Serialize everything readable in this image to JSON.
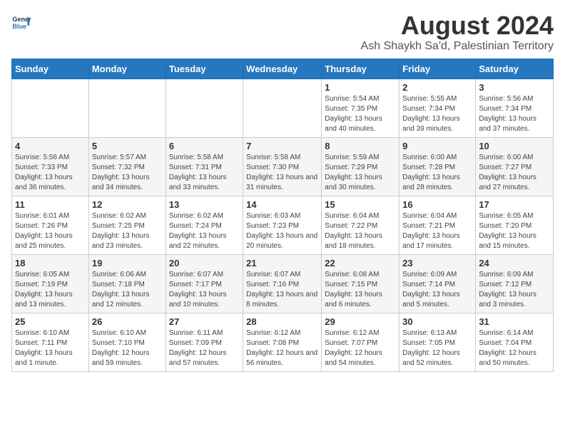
{
  "logo": {
    "text_general": "General",
    "text_blue": "Blue"
  },
  "title": "August 2024",
  "subtitle": "Ash Shaykh Sa'd, Palestinian Territory",
  "days_of_week": [
    "Sunday",
    "Monday",
    "Tuesday",
    "Wednesday",
    "Thursday",
    "Friday",
    "Saturday"
  ],
  "weeks": [
    [
      {
        "day": "",
        "info": ""
      },
      {
        "day": "",
        "info": ""
      },
      {
        "day": "",
        "info": ""
      },
      {
        "day": "",
        "info": ""
      },
      {
        "day": "1",
        "info": "Sunrise: 5:54 AM\nSunset: 7:35 PM\nDaylight: 13 hours and 40 minutes."
      },
      {
        "day": "2",
        "info": "Sunrise: 5:55 AM\nSunset: 7:34 PM\nDaylight: 13 hours and 39 minutes."
      },
      {
        "day": "3",
        "info": "Sunrise: 5:56 AM\nSunset: 7:34 PM\nDaylight: 13 hours and 37 minutes."
      }
    ],
    [
      {
        "day": "4",
        "info": "Sunrise: 5:56 AM\nSunset: 7:33 PM\nDaylight: 13 hours and 36 minutes."
      },
      {
        "day": "5",
        "info": "Sunrise: 5:57 AM\nSunset: 7:32 PM\nDaylight: 13 hours and 34 minutes."
      },
      {
        "day": "6",
        "info": "Sunrise: 5:58 AM\nSunset: 7:31 PM\nDaylight: 13 hours and 33 minutes."
      },
      {
        "day": "7",
        "info": "Sunrise: 5:58 AM\nSunset: 7:30 PM\nDaylight: 13 hours and 31 minutes."
      },
      {
        "day": "8",
        "info": "Sunrise: 5:59 AM\nSunset: 7:29 PM\nDaylight: 13 hours and 30 minutes."
      },
      {
        "day": "9",
        "info": "Sunrise: 6:00 AM\nSunset: 7:28 PM\nDaylight: 13 hours and 28 minutes."
      },
      {
        "day": "10",
        "info": "Sunrise: 6:00 AM\nSunset: 7:27 PM\nDaylight: 13 hours and 27 minutes."
      }
    ],
    [
      {
        "day": "11",
        "info": "Sunrise: 6:01 AM\nSunset: 7:26 PM\nDaylight: 13 hours and 25 minutes."
      },
      {
        "day": "12",
        "info": "Sunrise: 6:02 AM\nSunset: 7:25 PM\nDaylight: 13 hours and 23 minutes."
      },
      {
        "day": "13",
        "info": "Sunrise: 6:02 AM\nSunset: 7:24 PM\nDaylight: 13 hours and 22 minutes."
      },
      {
        "day": "14",
        "info": "Sunrise: 6:03 AM\nSunset: 7:23 PM\nDaylight: 13 hours and 20 minutes."
      },
      {
        "day": "15",
        "info": "Sunrise: 6:04 AM\nSunset: 7:22 PM\nDaylight: 13 hours and 18 minutes."
      },
      {
        "day": "16",
        "info": "Sunrise: 6:04 AM\nSunset: 7:21 PM\nDaylight: 13 hours and 17 minutes."
      },
      {
        "day": "17",
        "info": "Sunrise: 6:05 AM\nSunset: 7:20 PM\nDaylight: 13 hours and 15 minutes."
      }
    ],
    [
      {
        "day": "18",
        "info": "Sunrise: 6:05 AM\nSunset: 7:19 PM\nDaylight: 13 hours and 13 minutes."
      },
      {
        "day": "19",
        "info": "Sunrise: 6:06 AM\nSunset: 7:18 PM\nDaylight: 13 hours and 12 minutes."
      },
      {
        "day": "20",
        "info": "Sunrise: 6:07 AM\nSunset: 7:17 PM\nDaylight: 13 hours and 10 minutes."
      },
      {
        "day": "21",
        "info": "Sunrise: 6:07 AM\nSunset: 7:16 PM\nDaylight: 13 hours and 8 minutes."
      },
      {
        "day": "22",
        "info": "Sunrise: 6:08 AM\nSunset: 7:15 PM\nDaylight: 13 hours and 6 minutes."
      },
      {
        "day": "23",
        "info": "Sunrise: 6:09 AM\nSunset: 7:14 PM\nDaylight: 13 hours and 5 minutes."
      },
      {
        "day": "24",
        "info": "Sunrise: 6:09 AM\nSunset: 7:12 PM\nDaylight: 13 hours and 3 minutes."
      }
    ],
    [
      {
        "day": "25",
        "info": "Sunrise: 6:10 AM\nSunset: 7:11 PM\nDaylight: 13 hours and 1 minute."
      },
      {
        "day": "26",
        "info": "Sunrise: 6:10 AM\nSunset: 7:10 PM\nDaylight: 12 hours and 59 minutes."
      },
      {
        "day": "27",
        "info": "Sunrise: 6:11 AM\nSunset: 7:09 PM\nDaylight: 12 hours and 57 minutes."
      },
      {
        "day": "28",
        "info": "Sunrise: 6:12 AM\nSunset: 7:08 PM\nDaylight: 12 hours and 56 minutes."
      },
      {
        "day": "29",
        "info": "Sunrise: 6:12 AM\nSunset: 7:07 PM\nDaylight: 12 hours and 54 minutes."
      },
      {
        "day": "30",
        "info": "Sunrise: 6:13 AM\nSunset: 7:05 PM\nDaylight: 12 hours and 52 minutes."
      },
      {
        "day": "31",
        "info": "Sunrise: 6:14 AM\nSunset: 7:04 PM\nDaylight: 12 hours and 50 minutes."
      }
    ]
  ]
}
